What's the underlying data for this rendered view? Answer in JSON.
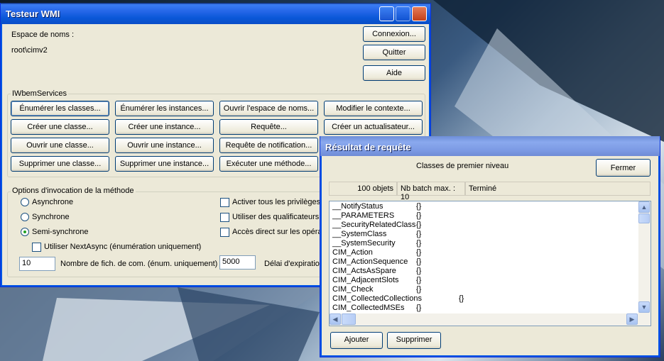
{
  "main_window": {
    "title": "Testeur WMI",
    "namespace_label": "Espace de noms :",
    "namespace_value": "root\\cimv2",
    "connect": "Connexion...",
    "quit": "Quitter",
    "help": "Aide",
    "iwbem_group": "IWbemServices",
    "services": [
      [
        "Énumérer les classes...",
        "Énumérer les instances...",
        "Ouvrir l'espace de noms...",
        "Modifier le contexte..."
      ],
      [
        "Créer une classe...",
        "Créer une instance...",
        "Requête...",
        "Créer un actualisateur..."
      ],
      [
        "Ouvrir une classe...",
        "Ouvrir une instance...",
        "Requête de notification...",
        ""
      ],
      [
        "Supprimer une classe...",
        "Supprimer une instance...",
        "Exécuter une méthode...",
        ""
      ]
    ],
    "options_group": "Options d'invocation de la méthode",
    "radio_async": "Asynchrone",
    "radio_sync": "Synchrone",
    "radio_semisync": "Semi-synchrone",
    "check_nextasync": "Utiliser NextAsync (énumération uniquement)",
    "enum_count_value": "10",
    "enum_count_label": "Nombre de fich. de com. (énum. uniquement)",
    "timeout_value": "5000",
    "timeout_label": "Délai d'expiration",
    "check_privileges": "Activer tous les privilèges",
    "check_qualifiers": "Utiliser des qualificateurs n",
    "check_direct": "Accès direct sur les opérat"
  },
  "result_window": {
    "title": "Résultat de requête",
    "heading": "Classes de premier niveau",
    "close": "Fermer",
    "status_count": "100 objets",
    "status_batch": "Nb batch max. : 10",
    "status_state": "Terminé",
    "rows": [
      {
        "name": "__NotifyStatus",
        "value": "{}"
      },
      {
        "name": "__PARAMETERS",
        "value": "{}"
      },
      {
        "name": "__SecurityRelatedClass",
        "value": "{}"
      },
      {
        "name": "__SystemClass",
        "value": "{}"
      },
      {
        "name": "__SystemSecurity",
        "value": "{}"
      },
      {
        "name": "CIM_Action",
        "value": "{}"
      },
      {
        "name": "CIM_ActionSequence",
        "value": "{}"
      },
      {
        "name": "CIM_ActsAsSpare",
        "value": "{}"
      },
      {
        "name": "CIM_AdjacentSlots",
        "value": "{}"
      },
      {
        "name": "CIM_Check",
        "value": "{}"
      },
      {
        "name": "CIM_CollectedCollections",
        "value": "{}"
      },
      {
        "name": "CIM_CollectedMSEs",
        "value": "{}"
      }
    ],
    "add": "Ajouter",
    "delete": "Supprimer"
  }
}
